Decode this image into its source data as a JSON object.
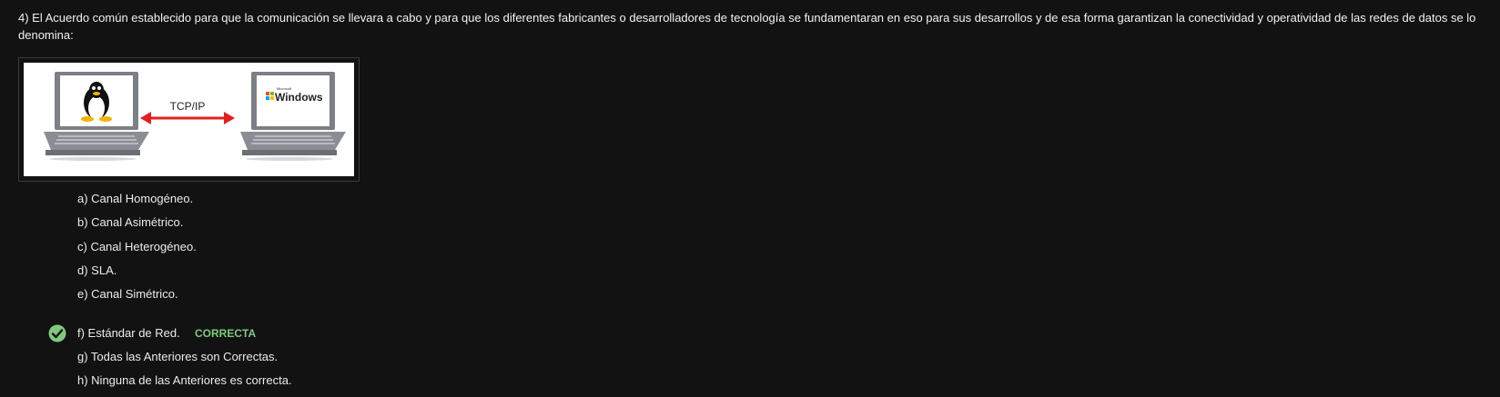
{
  "question": {
    "text": "4) El Acuerdo común establecido para que la comunicación se llevara a cabo y para que los diferentes fabricantes o desarrolladores de tecnología se fundamentaran en eso para sus desarrollos y de esa forma garantizan la conectividad y operatividad de las redes de datos se lo denomina:"
  },
  "figure": {
    "protocol_label": "TCP/IP",
    "left_os_icon": "linux-tux-icon",
    "right_os_icon": "windows-logo-icon",
    "right_os_label": "Windows",
    "right_os_small_label": "Microsoft"
  },
  "options": [
    {
      "label": "a) Canal Homogéneo."
    },
    {
      "label": "b) Canal Asimétrico."
    },
    {
      "label": "c) Canal Heterogéneo."
    },
    {
      "label": "d) SLA."
    },
    {
      "label": "e) Canal Simétrico."
    },
    {
      "label": "f) Estándar de Red.",
      "status": "CORRECTA"
    },
    {
      "label": "g) Todas las Anteriores son Correctas."
    },
    {
      "label": "h) Ninguna de las Anteriores es correcta."
    }
  ],
  "colors": {
    "background": "#121212",
    "correct": "#7fc97f",
    "arrow": "#e02020"
  }
}
